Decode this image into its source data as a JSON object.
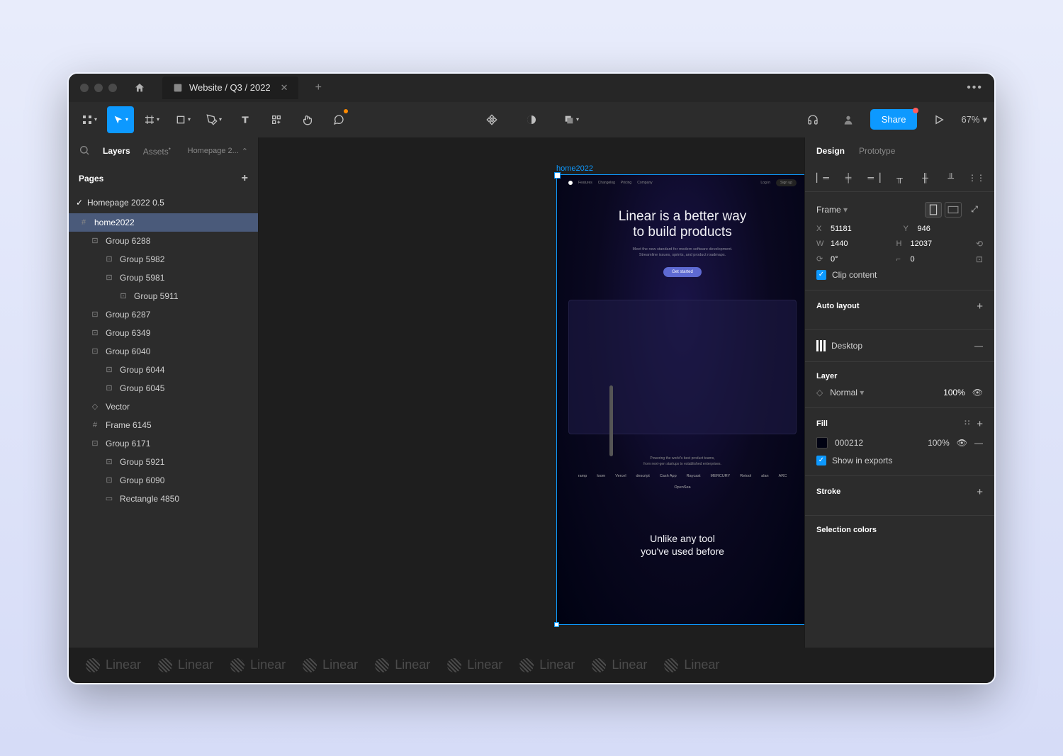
{
  "titlebar": {
    "tab_title": "Website / Q3 / 2022"
  },
  "toolbar": {
    "share_label": "Share",
    "zoom": "67%"
  },
  "left_panel": {
    "tabs": {
      "layers": "Layers",
      "assets": "Assets"
    },
    "breadcrumb": "Homepage 2...",
    "pages_header": "Pages",
    "pages": [
      {
        "name": "Homepage 2022 0.5",
        "current": true
      }
    ],
    "layers": [
      {
        "name": "home2022",
        "icon": "frame",
        "indent": 0,
        "selected": true
      },
      {
        "name": "Group 6288",
        "icon": "group",
        "indent": 1
      },
      {
        "name": "Group 5982",
        "icon": "group",
        "indent": 2
      },
      {
        "name": "Group 5981",
        "icon": "group",
        "indent": 2
      },
      {
        "name": "Group 5911",
        "icon": "group",
        "indent": 3
      },
      {
        "name": "Group 6287",
        "icon": "group",
        "indent": 1
      },
      {
        "name": "Group 6349",
        "icon": "group",
        "indent": 1
      },
      {
        "name": "Group 6040",
        "icon": "group",
        "indent": 1
      },
      {
        "name": "Group 6044",
        "icon": "group",
        "indent": 2
      },
      {
        "name": "Group 6045",
        "icon": "group",
        "indent": 2
      },
      {
        "name": "Vector",
        "icon": "vector",
        "indent": 1
      },
      {
        "name": "Frame 6145",
        "icon": "frame",
        "indent": 1
      },
      {
        "name": "Group 6171",
        "icon": "group",
        "indent": 1
      },
      {
        "name": "Group 5921",
        "icon": "group",
        "indent": 2
      },
      {
        "name": "Group 6090",
        "icon": "group",
        "indent": 2
      },
      {
        "name": "Rectangle 4850",
        "icon": "rect",
        "indent": 2
      }
    ]
  },
  "canvas": {
    "frame_label": "home2022",
    "hero_title_1": "Linear is a better way",
    "hero_title_2": "to build products",
    "hero_sub_1": "Meet the new standard for modern software development.",
    "hero_sub_2": "Streamline issues, sprints, and product roadmaps.",
    "cta": "Get started",
    "nav": [
      "Features",
      "Changelog",
      "Pricing",
      "Company"
    ],
    "nav_right": [
      "Log in",
      "Sign up"
    ],
    "trusted_1": "Powering the world's best product teams,",
    "trusted_2": "from next-gen startups to established enterprises.",
    "logos": [
      "ramp",
      "loom",
      "Vercel",
      "descript",
      "Cash App",
      "Raycast",
      "MERCURY",
      "Retool",
      "alan",
      "ARC",
      "OpenSea"
    ],
    "hero2_1": "Unlike any tool",
    "hero2_2": "you've used before"
  },
  "right_panel": {
    "tabs": {
      "design": "Design",
      "prototype": "Prototype"
    },
    "frame_label": "Frame",
    "props": {
      "x": "51181",
      "y": "946",
      "w": "1440",
      "h": "12037",
      "rotation": "0°",
      "radius": "0"
    },
    "clip_content": "Clip content",
    "auto_layout": "Auto layout",
    "layout_label": "Desktop",
    "layer_header": "Layer",
    "blend_mode": "Normal",
    "opacity": "100%",
    "fill_header": "Fill",
    "fill_hex": "000212",
    "fill_opacity": "100%",
    "show_exports": "Show in exports",
    "stroke_header": "Stroke",
    "selection_colors": "Selection colors"
  },
  "footer": {
    "brand": "Linear"
  }
}
